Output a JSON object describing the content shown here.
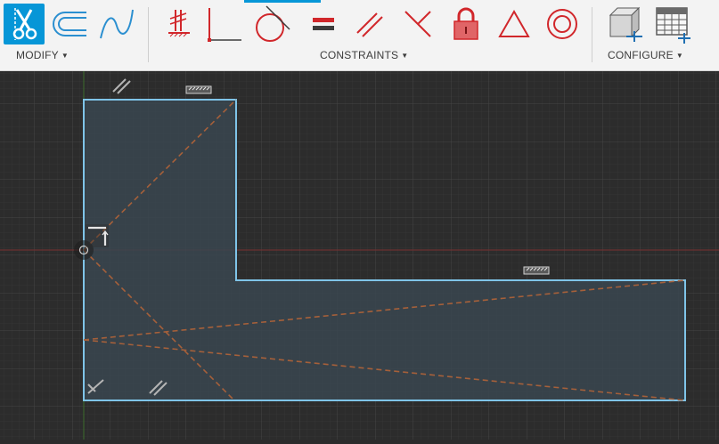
{
  "toolbar": {
    "groups": {
      "modify": {
        "label": "MODIFY"
      },
      "constraints": {
        "label": "CONSTRAINTS"
      },
      "configure": {
        "label": "CONFIGURE"
      }
    },
    "tools": {
      "modify": [
        "trim-icon",
        "offset-icon",
        "spline-icon"
      ],
      "constraints": [
        "coincident-icon",
        "collinear-icon",
        "tangent-icon",
        "equal-icon",
        "parallel-icon",
        "perpendicular-icon",
        "fix-unfix-icon",
        "symmetry-icon",
        "concentric-icon"
      ],
      "configure": [
        "change-parameters-icon",
        "configuration-table-icon"
      ]
    },
    "active_tool": "trim-icon"
  },
  "colors": {
    "accent": "#0696d7",
    "canvas_background": "#2c2c2c",
    "profile_outline": "#7fc4e8",
    "profile_fill": "#3a4650",
    "construction_line": "#a6603a",
    "x_axis": "#7a2f2f",
    "y_axis": "#3b6b2c",
    "constraint_red": "#d1272b"
  },
  "canvas": {
    "constraint_glyphs": [
      "parallel",
      "horizontal",
      "horizontal",
      "perpendicular",
      "parallel",
      "horizontal-vertical"
    ]
  }
}
